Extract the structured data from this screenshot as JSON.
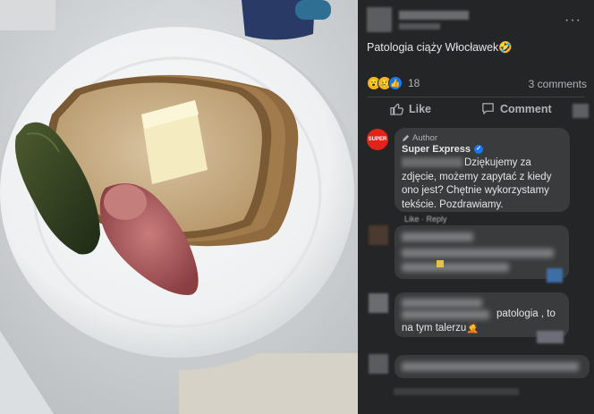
{
  "post": {
    "caption": "Patologia ciąży Włocławek🤣",
    "more_label": "···",
    "reactions": {
      "emojis": [
        "😮",
        "😢",
        "👍"
      ],
      "count": "18"
    },
    "comments_count": "3 comments",
    "actions": {
      "like": "Like",
      "comment": "Comment"
    }
  },
  "author_comment": {
    "avatar_text": "SUPER",
    "author_tag": "Author",
    "name": "Super Express",
    "text": "Dziękujemy za zdjęcie, możemy zapytać z kiedy ono jest? Chętnie wykorzystamy tekście. Pozdrawiamy.",
    "meta": "Like · Reply"
  },
  "comments": [
    {
      "text": ""
    },
    {
      "text": "patologia , to na tym talerzu🤦"
    },
    {
      "text": ""
    }
  ],
  "colors": {
    "panel": "#242526",
    "bubble": "#3a3b3c",
    "text": "#e4e6eb",
    "muted": "#b0b3b8",
    "accent": "#1877f2"
  }
}
